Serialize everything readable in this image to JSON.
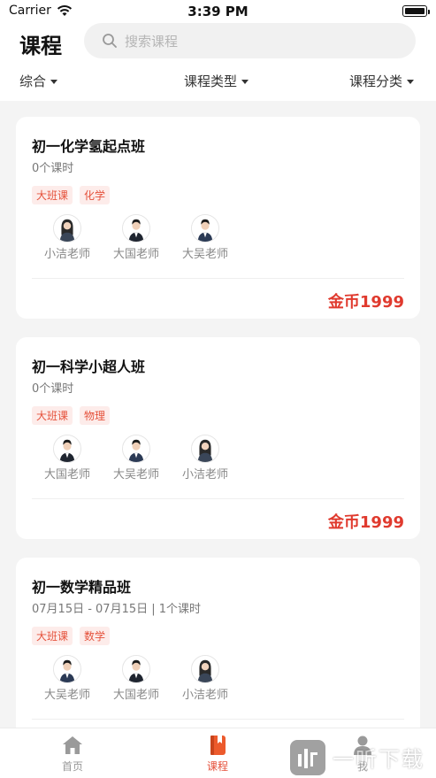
{
  "status_bar": {
    "carrier": "Carrier",
    "time": "3:39 PM"
  },
  "header": {
    "title": "课程",
    "search_placeholder": "搜索课程"
  },
  "filters": [
    {
      "label": "综合"
    },
    {
      "label": "课程类型"
    },
    {
      "label": "课程分类"
    }
  ],
  "courses": [
    {
      "title": "初一化学氢起点班",
      "meta": "0个课时",
      "tags": [
        "大班课",
        "化学"
      ],
      "teachers": [
        "小洁老师",
        "大国老师",
        "大吴老师"
      ],
      "price": "金币1999"
    },
    {
      "title": "初一科学小超人班",
      "meta": "0个课时",
      "tags": [
        "大班课",
        "物理"
      ],
      "teachers": [
        "大国老师",
        "大吴老师",
        "小洁老师"
      ],
      "price": "金币1999"
    },
    {
      "title": "初一数学精品班",
      "meta": "07月15日 - 07月15日 | 1个课时",
      "tags": [
        "大班课",
        "数学"
      ],
      "teachers": [
        "大吴老师",
        "大国老师",
        "小洁老师"
      ],
      "price": ""
    }
  ],
  "tab_bar": {
    "items": [
      {
        "label": "首页",
        "icon": "home-icon"
      },
      {
        "label": "课程",
        "icon": "course-book-icon",
        "active": true
      },
      {
        "label": "我",
        "icon": "profile-icon"
      }
    ]
  },
  "watermark": {
    "text": "一听下载"
  },
  "colors": {
    "accent": "#e5513b",
    "price": "#e03a2e",
    "tag_bg": "#fdecea"
  }
}
